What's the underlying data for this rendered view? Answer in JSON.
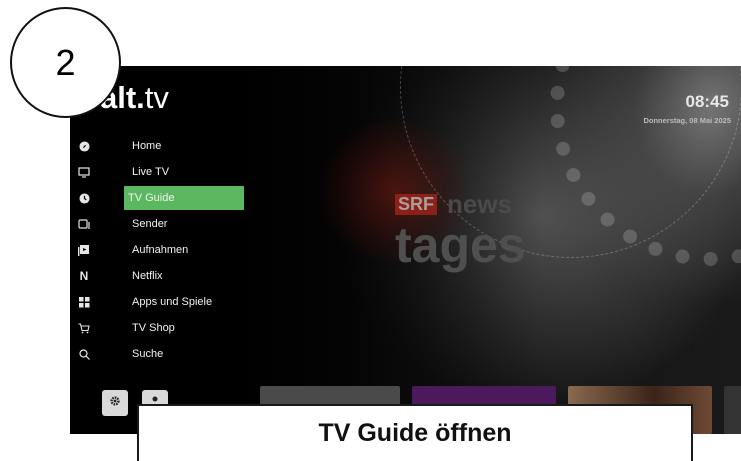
{
  "step_number": "2",
  "caption": "TV Guide öffnen",
  "header": {
    "brand_bold": "alt.",
    "brand_light": "tv",
    "time": "08:45",
    "date": "Donnerstag, 08 Mai 2025"
  },
  "menu": {
    "items": [
      {
        "label": "Home",
        "icon": "compass-icon"
      },
      {
        "label": "Live TV",
        "icon": "tv-icon"
      },
      {
        "label": "TV Guide",
        "icon": "clock-icon",
        "active": true
      },
      {
        "label": "Sender",
        "icon": "channels-icon"
      },
      {
        "label": "Aufnahmen",
        "icon": "recordings-icon"
      },
      {
        "label": "Netflix",
        "icon": "netflix-icon"
      },
      {
        "label": "Apps und Spiele",
        "icon": "apps-grid-icon"
      },
      {
        "label": "TV Shop",
        "icon": "cart-icon"
      },
      {
        "label": "Suche",
        "icon": "search-icon"
      }
    ]
  },
  "background": {
    "channel_logo": "SRF",
    "channel_word": "news",
    "program": "tages"
  },
  "colors": {
    "active_item": "#5cb860",
    "screen_bg": "#0d0d0d"
  }
}
